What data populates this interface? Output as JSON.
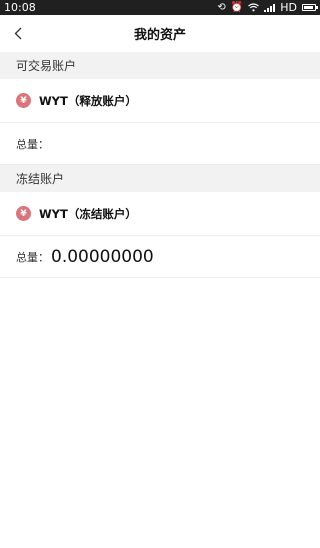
{
  "status_bar": {
    "time": "10:08",
    "network": "HD"
  },
  "nav": {
    "title": "我的资产"
  },
  "sections": [
    {
      "header": "可交易账户",
      "asset_icon": "yen-icon",
      "asset_name": "WYT（释放账户）",
      "total_label": "总量：",
      "total_value": ""
    },
    {
      "header": "冻结账户",
      "asset_icon": "yen-icon",
      "asset_name": "WYT（冻结账户）",
      "total_label": "总量：",
      "total_value": "0.00000000"
    }
  ],
  "colors": {
    "status_bar_bg": "#202020",
    "section_header_bg": "#f2f2f2",
    "yen_badge": "#d9757d"
  }
}
